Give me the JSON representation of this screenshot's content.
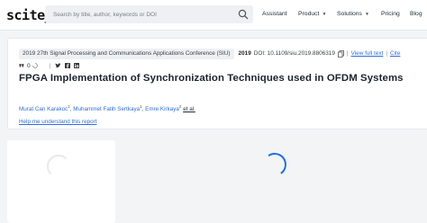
{
  "header": {
    "logo": "scite_",
    "search_placeholder": "Search by title, author, keywords or DOI",
    "nav": {
      "assistant": "Assistant",
      "product": "Product",
      "solutions": "Solutions",
      "pricing": "Pricing",
      "blog": "Blog"
    }
  },
  "paper": {
    "conference": "2019 27th Signal Processing and Communications Applications Conference (SIU)",
    "year": "2019",
    "doi": "DOI: 10.1109/siu.2019.8806319",
    "view_full_text": "View full text",
    "cite": "Cite",
    "title": "FPGA Implementation of Synchronization Techniques used in OFDM Systems",
    "authors": [
      {
        "name": "Murat Can Karakoc",
        "sup": "1"
      },
      {
        "name": "Muhammet Fatih Sertkaya",
        "sup": "1"
      },
      {
        "name": "Emre Kirkaya",
        "sup": "2"
      }
    ],
    "et_al": "et al.",
    "help_link": "Help me understand this report",
    "citation_count": "0"
  },
  "colors": {
    "link": "#2f6fdb",
    "spinner": "#1c6ef2",
    "background": "#f3f4f6"
  },
  "icons": [
    "search-icon",
    "quote-icon",
    "spinner-icon",
    "twitter-icon",
    "facebook-icon",
    "linkedin-icon",
    "copy-icon",
    "chevron-down-icon"
  ]
}
